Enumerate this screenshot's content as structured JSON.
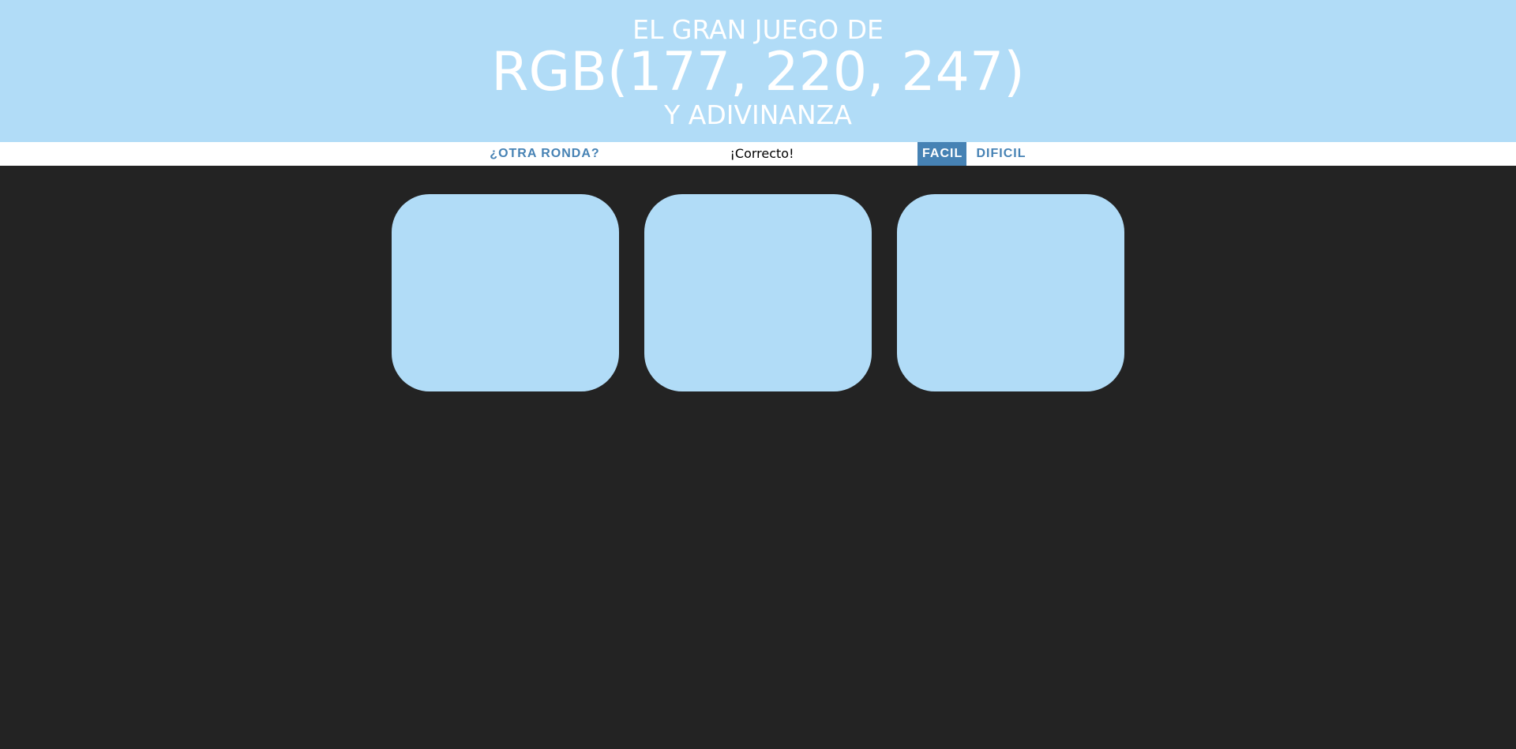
{
  "header": {
    "line1": "EL GRAN JUEGO DE",
    "color_display": "RGB(177, 220, 247)",
    "line3": "Y ADIVINANZA",
    "background_color": "#b1dcf7"
  },
  "stripe": {
    "reset_label": "¿OTRA RONDA?",
    "message": "¡Correcto!",
    "easy_label": "FACIL",
    "hard_label": "DIFICIL",
    "selected_mode": "FACIL",
    "accent_color": "#4682b4"
  },
  "squares": [
    {
      "color": "#b1dcf7"
    },
    {
      "color": "#b1dcf7"
    },
    {
      "color": "#b1dcf7"
    }
  ],
  "page": {
    "background_color": "#232323"
  }
}
